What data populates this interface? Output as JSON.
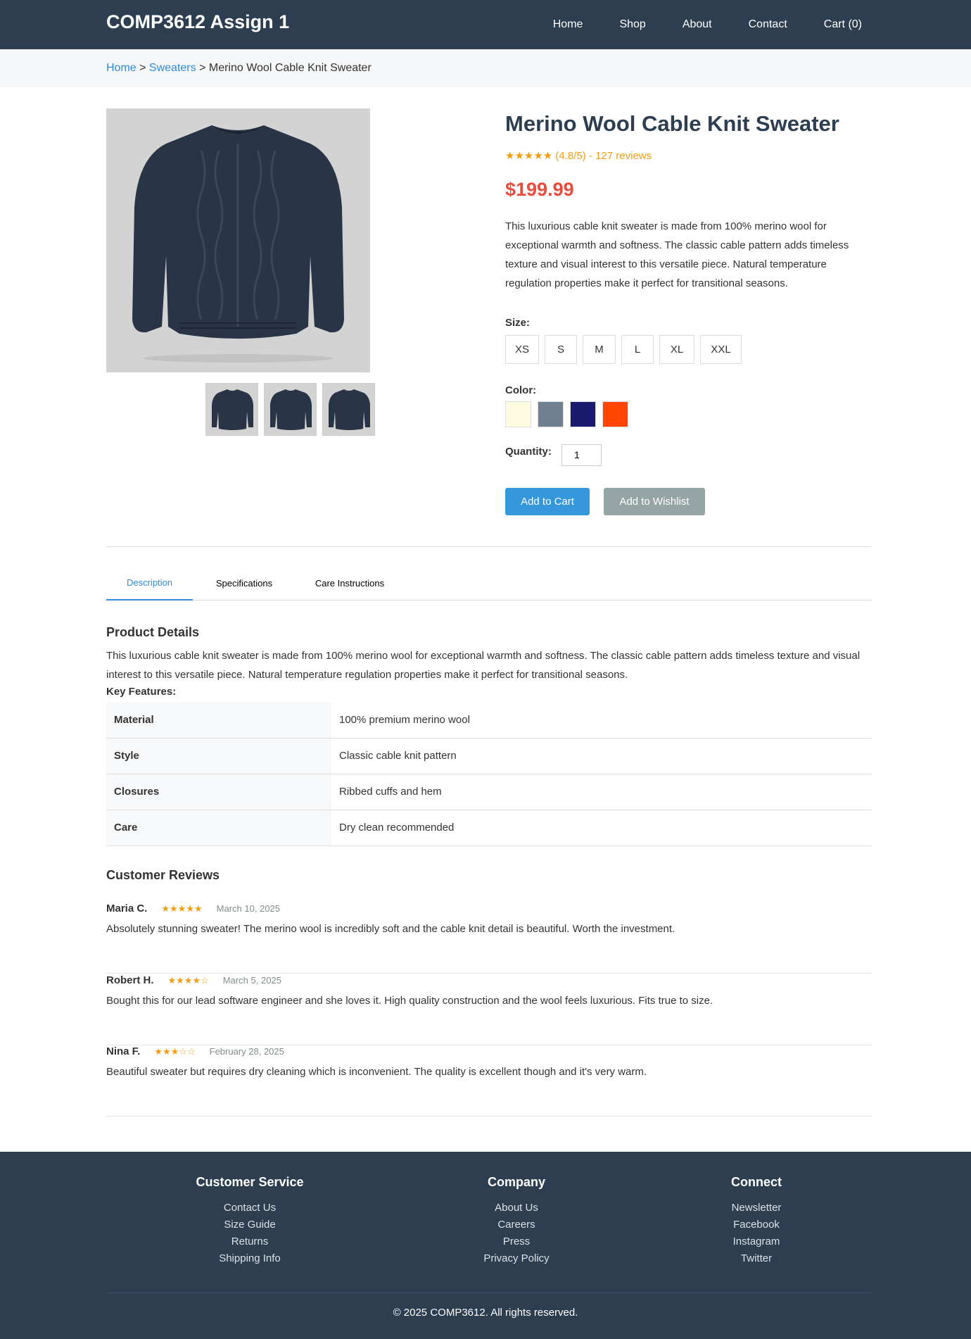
{
  "header": {
    "brand": "COMP3612 Assign 1",
    "nav": [
      "Home",
      "Shop",
      "About",
      "Contact",
      "Cart (0)"
    ]
  },
  "breadcrumb": {
    "home": "Home",
    "sep1": " > ",
    "category": "Sweaters",
    "sep2": " > ",
    "current": "Merino Wool Cable Knit Sweater"
  },
  "product": {
    "title": "Merino Wool Cable Knit Sweater",
    "rating": "★★★★★ (4.8/5) - 127 reviews",
    "price": "$199.99",
    "description": "This luxurious cable knit sweater is made from 100% merino wool for exceptional warmth and softness. The classic cable pattern adds timeless texture and visual interest to this versatile piece. Natural temperature regulation properties make it perfect for transitional seasons.",
    "size_label": "Size:",
    "sizes": [
      "XS",
      "S",
      "M",
      "L",
      "XL",
      "XXL"
    ],
    "color_label": "Color:",
    "colors": [
      "#fffbe0",
      "#708090",
      "#1a1a6e",
      "#ff4500"
    ],
    "quantity_label": "Quantity:",
    "quantity": "1",
    "add_to_cart": "Add to Cart",
    "add_to_wishlist": "Add to Wishlist",
    "image_color": "#2a3447"
  },
  "tabs": [
    "Description",
    "Specifications",
    "Care Instructions"
  ],
  "details": {
    "heading": "Product Details",
    "paragraph": "This luxurious cable knit sweater is made from 100% merino wool for exceptional warmth and softness. The classic cable pattern adds timeless texture and visual interest to this versatile piece. Natural temperature regulation properties make it perfect for transitional seasons.",
    "key_features": "Key Features:",
    "specs": [
      {
        "k": "Material",
        "v": "100% premium merino wool"
      },
      {
        "k": "Style",
        "v": "Classic cable knit pattern"
      },
      {
        "k": "Closures",
        "v": "Ribbed cuffs and hem"
      },
      {
        "k": "Care",
        "v": "Dry clean recommended"
      }
    ]
  },
  "reviews": {
    "heading": "Customer Reviews",
    "items": [
      {
        "name": "Maria C.",
        "stars": "★★★★★",
        "date": "March 10, 2025",
        "text": "Absolutely stunning sweater! The merino wool is incredibly soft and the cable knit detail is beautiful. Worth the investment."
      },
      {
        "name": "Robert H.",
        "stars": "★★★★☆",
        "date": "March 5, 2025",
        "text": "Bought this for our lead software engineer and she loves it. High quality construction and the wool feels luxurious. Fits true to size."
      },
      {
        "name": "Nina F.",
        "stars": "★★★☆☆",
        "date": "February 28, 2025",
        "text": "Beautiful sweater but requires dry cleaning which is inconvenient. The quality is excellent though and it's very warm."
      }
    ]
  },
  "footer": {
    "columns": [
      {
        "title": "Customer Service",
        "links": [
          "Contact Us",
          "Size Guide",
          "Returns",
          "Shipping Info"
        ]
      },
      {
        "title": "Company",
        "links": [
          "About Us",
          "Careers",
          "Press",
          "Privacy Policy"
        ]
      },
      {
        "title": "Connect",
        "links": [
          "Newsletter",
          "Facebook",
          "Instagram",
          "Twitter"
        ]
      }
    ],
    "copyright": "© 2025 COMP3612. All rights reserved."
  }
}
